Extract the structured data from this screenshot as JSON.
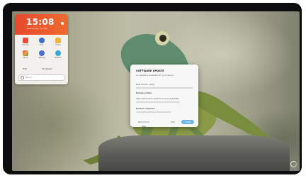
{
  "clock": {
    "time": "15:08",
    "date": "Wednesday, 24 May"
  },
  "launcher": {
    "apps": [
      {
        "label": "Chrome",
        "icon": "chrome-icon",
        "color": "#e94b35"
      },
      {
        "label": "Files",
        "icon": "files-icon",
        "color": "#3c6fc4"
      },
      {
        "label": "Notes",
        "icon": "notes-icon",
        "color": "#f2b43c"
      },
      {
        "label": "Store",
        "icon": "store-icon",
        "color": "#d84b77"
      },
      {
        "label": "Settings",
        "icon": "settings-icon",
        "color": "#4a6fd8"
      },
      {
        "label": "Weather",
        "icon": "weather-icon",
        "color": "#39a7d9"
      }
    ],
    "tools": [
      "Edit",
      "Shutdown"
    ],
    "search_placeholder": "Search"
  },
  "dialog": {
    "title": "SOFTWARE UPDATE",
    "subtitle": "An update is available for your device",
    "lines": [
      "New version ready",
      "Release notes",
      "Improvements to performance and stability",
      "Restart required"
    ],
    "buttons": {
      "later": "Remind me later",
      "skip": "Skip",
      "install": "Install"
    }
  },
  "colors": {
    "accent": "#ea542e",
    "install_button": "#6fb2e6"
  }
}
